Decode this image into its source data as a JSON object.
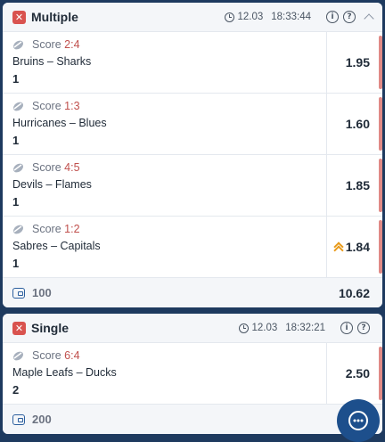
{
  "colors": {
    "background": "#1e3a5f",
    "accent_red": "#d9534f",
    "score_red": "#c0504d",
    "arrow_orange": "#e89a1a",
    "chat_blue": "#1d4f8c"
  },
  "multiple": {
    "title": "Multiple",
    "date": "12.03",
    "time": "18:33:44",
    "info_icon": "i",
    "help_icon": "?",
    "bets": [
      {
        "score_label": "Score",
        "score": "2:4",
        "teams": "Bruins – Sharks",
        "pick": "1",
        "odds": "1.95",
        "trend": "none"
      },
      {
        "score_label": "Score",
        "score": "1:3",
        "teams": "Hurricanes – Blues",
        "pick": "1",
        "odds": "1.60",
        "trend": "none"
      },
      {
        "score_label": "Score",
        "score": "4:5",
        "teams": "Devils – Flames",
        "pick": "1",
        "odds": "1.85",
        "trend": "none"
      },
      {
        "score_label": "Score",
        "score": "1:2",
        "teams": "Sabres – Capitals",
        "pick": "1",
        "odds": "1.84",
        "trend": "up"
      }
    ],
    "stake": "100",
    "total_odds": "10.62"
  },
  "single": {
    "title": "Single",
    "date": "12.03",
    "time": "18:32:21",
    "info_icon": "i",
    "help_icon": "?",
    "bets": [
      {
        "score_label": "Score",
        "score": "6:4",
        "teams": "Maple Leafs – Ducks",
        "pick": "2",
        "odds": "2.50",
        "trend": "none"
      }
    ],
    "stake": "200"
  }
}
